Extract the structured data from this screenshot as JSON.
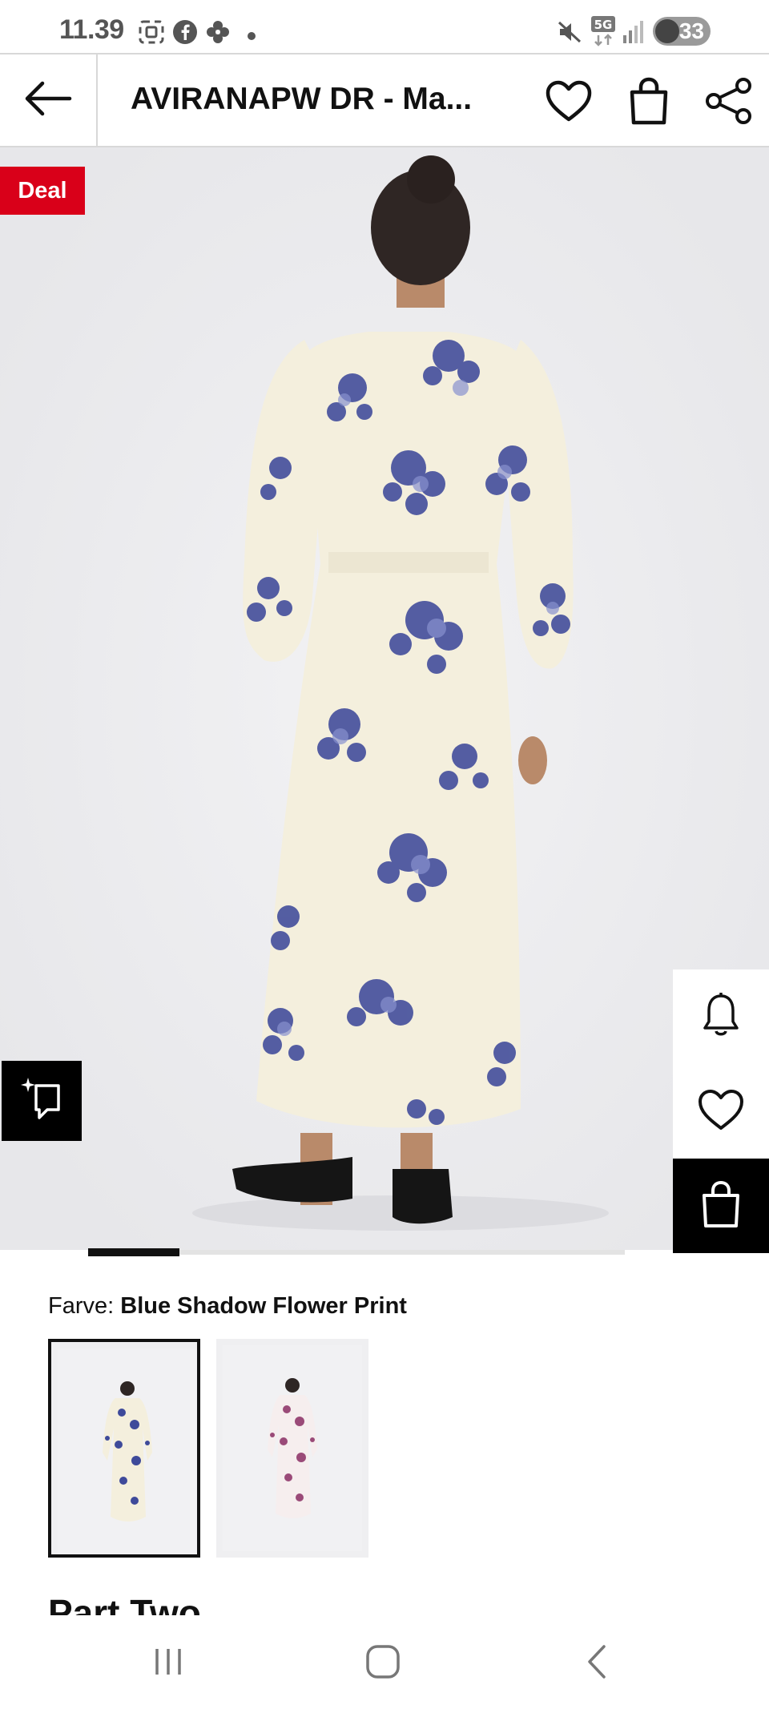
{
  "status_bar": {
    "time": "11.39",
    "battery": "33",
    "network": "5G",
    "icons": [
      "screenshot-icon",
      "facebook-icon",
      "pinwheel-icon",
      "dot-icon",
      "mute-icon",
      "signal-icon"
    ]
  },
  "header": {
    "title": "AVIRANAPW DR - Ma...",
    "icons": [
      "back-arrow-icon",
      "heart-icon",
      "bag-icon",
      "share-icon"
    ]
  },
  "product": {
    "badge": "Deal",
    "image_alt": "Back view of a long cream dress with blue floral print and a tie belt",
    "carousel_progress": 0.17
  },
  "side_actions": {
    "icons": [
      "bell-icon",
      "heart-icon",
      "bag-icon"
    ]
  },
  "color": {
    "label": "Farve:",
    "value": "Blue Shadow Flower Print",
    "swatches": [
      {
        "name": "blue-shadow-flower-print",
        "selected": true,
        "accent": "#3f4a9c"
      },
      {
        "name": "pink-flower-print",
        "selected": false,
        "accent": "#9a4a78"
      }
    ]
  },
  "next_section": {
    "heading": "Part Two"
  },
  "colors": {
    "deal_red": "#d90019",
    "dark": "#000000",
    "image_bg": "#ececef",
    "dress_cream": "#f4efdd",
    "print_blue": "#3e4a9a"
  }
}
